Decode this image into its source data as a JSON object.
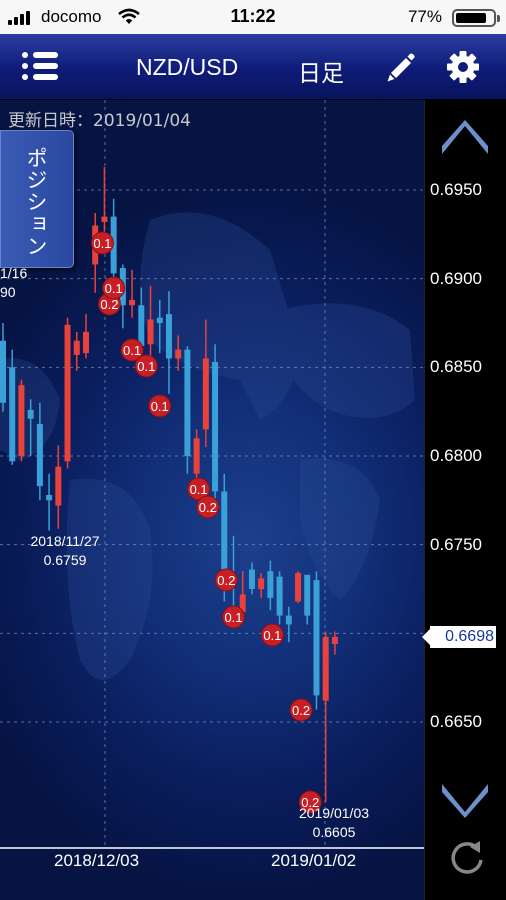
{
  "status_bar": {
    "carrier": "docomo",
    "time": "11:22",
    "battery": "77%"
  },
  "nav": {
    "menu_icon": "list-menu-icon",
    "pair": "NZD/USD",
    "period": "日足",
    "edit_icon": "pencil-icon",
    "settings_icon": "gear-icon"
  },
  "chart": {
    "updated": "更新日時：2019/01/04",
    "position_button": "ポジション",
    "current_price": "0.6698",
    "x_labels": [
      "2018/12/03",
      "2019/01/02"
    ],
    "annotations": [
      {
        "date": "2018/11/27",
        "price": "0.6759"
      },
      {
        "date": "2019/01/03",
        "price": "0.6605"
      }
    ],
    "cut_annotation": {
      "date": "1/16",
      "price": "90"
    },
    "colors": {
      "up": "#e8423b",
      "down": "#3aa0d8",
      "badge": "#c62026"
    }
  },
  "chart_data": {
    "type": "candlestick",
    "title": "NZD/USD",
    "interval": "日足",
    "ylim": [
      0.6605,
      0.6975
    ],
    "y_ticks": [
      0.695,
      0.69,
      0.685,
      0.68,
      0.675,
      0.67,
      0.665
    ],
    "grid": true,
    "candles": [
      {
        "o": 0.6865,
        "h": 0.6875,
        "l": 0.6825,
        "c": 0.683
      },
      {
        "o": 0.685,
        "h": 0.686,
        "l": 0.6795,
        "c": 0.6797
      },
      {
        "o": 0.68,
        "h": 0.6843,
        "l": 0.6797,
        "c": 0.684
      },
      {
        "o": 0.6826,
        "h": 0.6832,
        "l": 0.68,
        "c": 0.6821
      },
      {
        "o": 0.6818,
        "h": 0.683,
        "l": 0.6775,
        "c": 0.6783
      },
      {
        "o": 0.6778,
        "h": 0.679,
        "l": 0.6758,
        "c": 0.6775
      },
      {
        "o": 0.6772,
        "h": 0.6806,
        "l": 0.6759,
        "c": 0.6794
      },
      {
        "o": 0.6797,
        "h": 0.6878,
        "l": 0.6793,
        "c": 0.6874
      },
      {
        "o": 0.6857,
        "h": 0.687,
        "l": 0.6848,
        "c": 0.6865
      },
      {
        "o": 0.6858,
        "h": 0.688,
        "l": 0.6855,
        "c": 0.687
      },
      {
        "o": 0.6908,
        "h": 0.6937,
        "l": 0.6892,
        "c": 0.693
      },
      {
        "o": 0.6932,
        "h": 0.6963,
        "l": 0.6925,
        "c": 0.6935
      },
      {
        "o": 0.6935,
        "h": 0.6945,
        "l": 0.6892,
        "c": 0.6903
      },
      {
        "o": 0.6906,
        "h": 0.6908,
        "l": 0.6872,
        "c": 0.6885
      },
      {
        "o": 0.6885,
        "h": 0.6905,
        "l": 0.6878,
        "c": 0.6888
      },
      {
        "o": 0.6885,
        "h": 0.6895,
        "l": 0.6857,
        "c": 0.6862
      },
      {
        "o": 0.6863,
        "h": 0.6896,
        "l": 0.6855,
        "c": 0.6877
      },
      {
        "o": 0.6878,
        "h": 0.6888,
        "l": 0.6858,
        "c": 0.6875
      },
      {
        "o": 0.688,
        "h": 0.6893,
        "l": 0.6835,
        "c": 0.6855
      },
      {
        "o": 0.6855,
        "h": 0.6868,
        "l": 0.6848,
        "c": 0.686
      },
      {
        "o": 0.686,
        "h": 0.6862,
        "l": 0.679,
        "c": 0.68
      },
      {
        "o": 0.679,
        "h": 0.6815,
        "l": 0.6782,
        "c": 0.681
      },
      {
        "o": 0.6815,
        "h": 0.6877,
        "l": 0.6805,
        "c": 0.6855
      },
      {
        "o": 0.6853,
        "h": 0.6863,
        "l": 0.677,
        "c": 0.678
      },
      {
        "o": 0.678,
        "h": 0.679,
        "l": 0.6718,
        "c": 0.673
      },
      {
        "o": 0.6715,
        "h": 0.6755,
        "l": 0.6706,
        "c": 0.671
      },
      {
        "o": 0.6712,
        "h": 0.6735,
        "l": 0.6712,
        "c": 0.6722
      },
      {
        "o": 0.6736,
        "h": 0.674,
        "l": 0.6722,
        "c": 0.6725
      },
      {
        "o": 0.6725,
        "h": 0.6734,
        "l": 0.672,
        "c": 0.6731
      },
      {
        "o": 0.6735,
        "h": 0.6741,
        "l": 0.6713,
        "c": 0.672
      },
      {
        "o": 0.6732,
        "h": 0.6735,
        "l": 0.6705,
        "c": 0.671
      },
      {
        "o": 0.671,
        "h": 0.6715,
        "l": 0.6695,
        "c": 0.6705
      },
      {
        "o": 0.6718,
        "h": 0.6735,
        "l": 0.6717,
        "c": 0.6734
      },
      {
        "o": 0.6733,
        "h": 0.6733,
        "l": 0.6705,
        "c": 0.671
      },
      {
        "o": 0.673,
        "h": 0.6735,
        "l": 0.6657,
        "c": 0.6665
      },
      {
        "o": 0.6662,
        "h": 0.6701,
        "l": 0.6605,
        "c": 0.6698
      },
      {
        "o": 0.6694,
        "h": 0.6701,
        "l": 0.6688,
        "c": 0.6698
      }
    ],
    "trade_badges": [
      {
        "candle": 11,
        "value": "0.1"
      },
      {
        "candle": 11,
        "value": "0.2"
      },
      {
        "candle": 12,
        "value": "0.1"
      },
      {
        "candle": 14,
        "value": "0.1"
      },
      {
        "candle": 15,
        "value": "0.1"
      },
      {
        "candle": 17,
        "value": "0.1"
      },
      {
        "candle": 21,
        "value": "0.1"
      },
      {
        "candle": 22,
        "value": "0.2"
      },
      {
        "candle": 24,
        "value": "0.2"
      },
      {
        "candle": 25,
        "value": "0.1"
      },
      {
        "candle": 29,
        "value": "0.1"
      },
      {
        "candle": 32,
        "value": "0.2"
      },
      {
        "candle": 33,
        "value": "0.2"
      }
    ]
  }
}
